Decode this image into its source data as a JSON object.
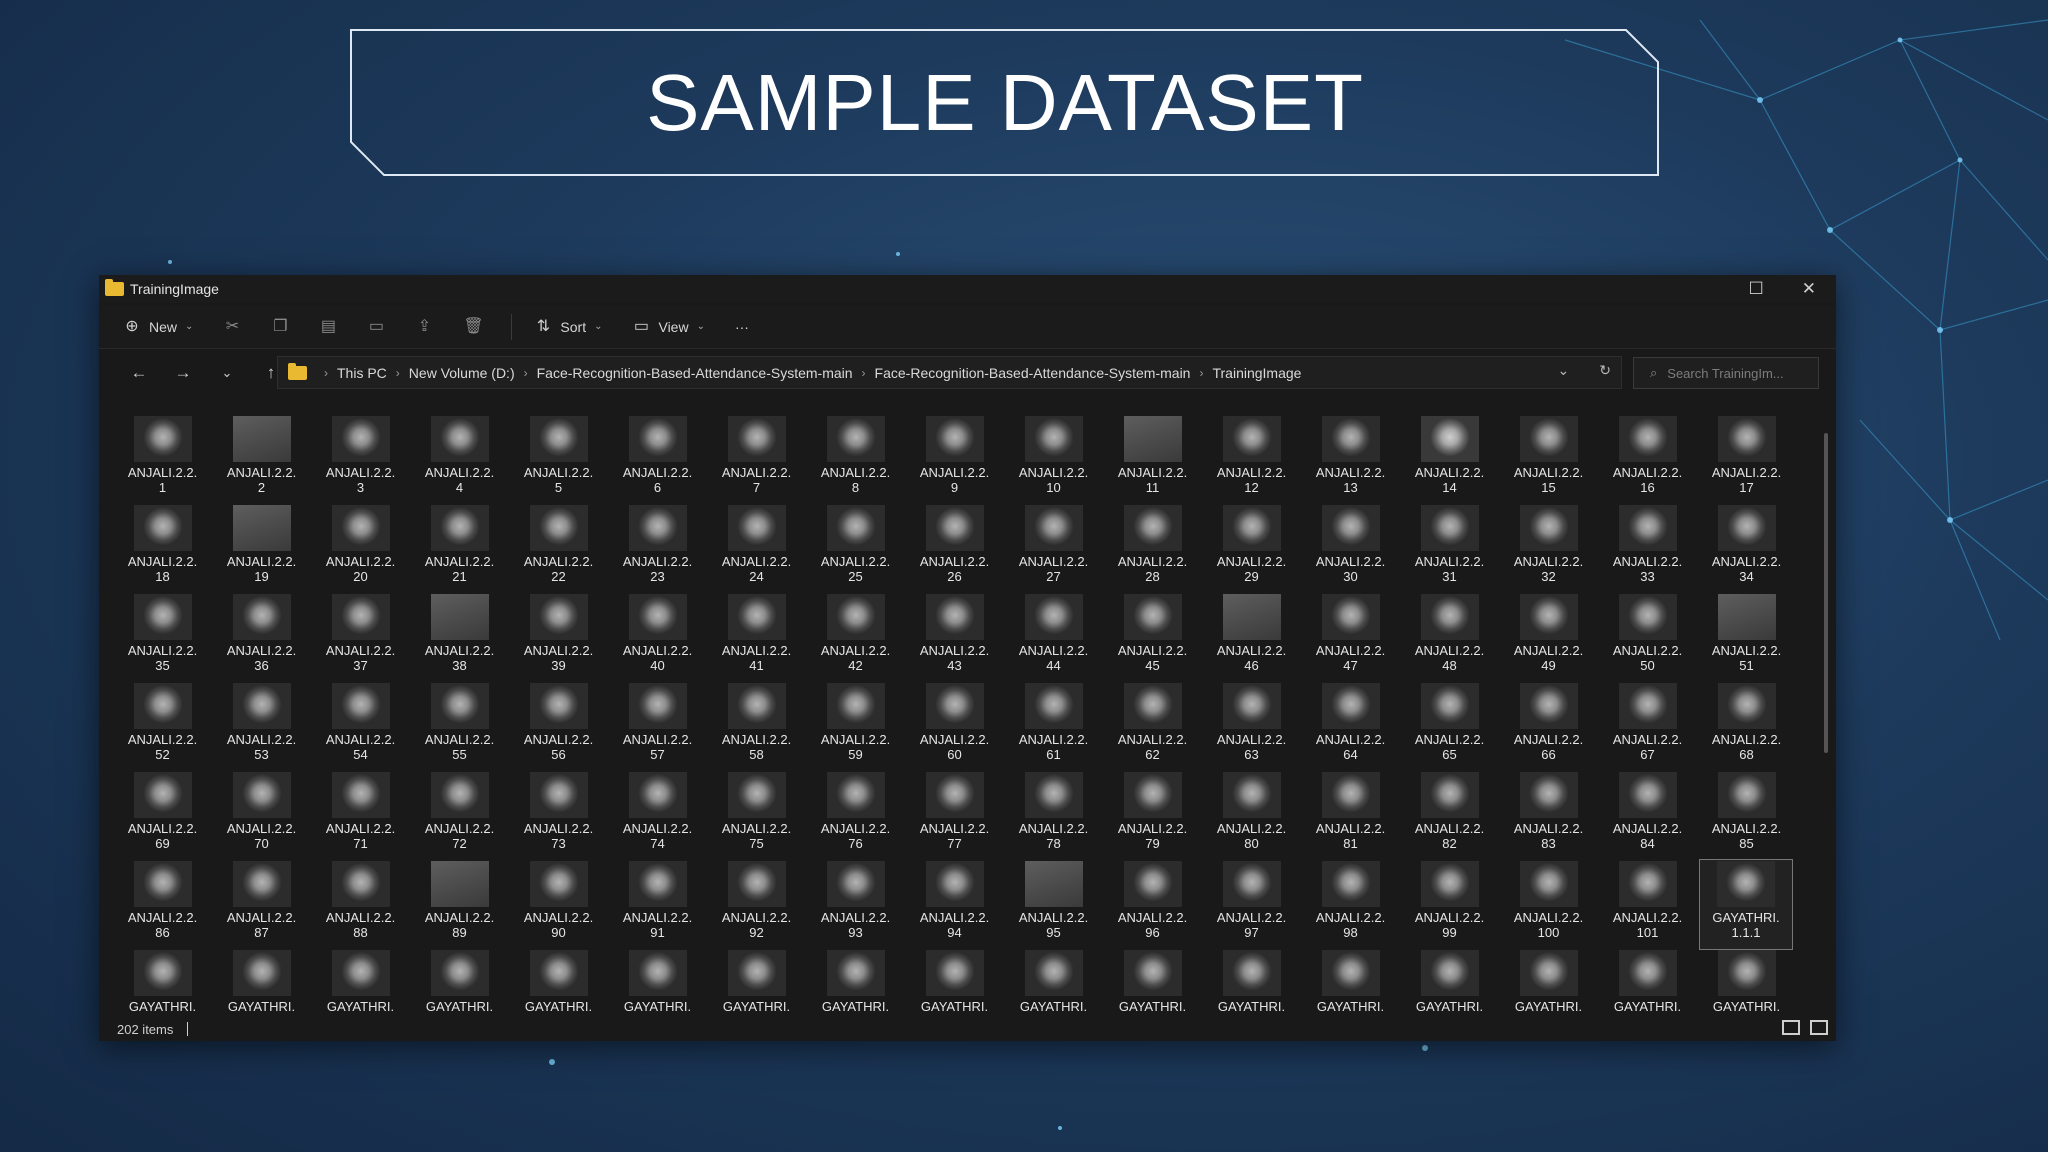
{
  "slide": {
    "title": "SAMPLE DATASET"
  },
  "window": {
    "title": "TrainingImage",
    "controls": {
      "maximize": "☐",
      "close": "✕"
    }
  },
  "toolbar": {
    "new_label": "New",
    "sort_label": "Sort",
    "view_label": "View",
    "more_label": "···"
  },
  "address": {
    "crumbs": [
      "This PC",
      "New Volume (D:)",
      "Face-Recognition-Based-Attendance-System-main",
      "Face-Recognition-Based-Attendance-System-main",
      "TrainingImage"
    ],
    "search_placeholder": "Search TrainingIm..."
  },
  "files": [
    {
      "line1": "ANJALI.2.2.",
      "line2": "1"
    },
    {
      "line1": "ANJALI.2.2.",
      "line2": "2",
      "alt": true
    },
    {
      "line1": "ANJALI.2.2.",
      "line2": "3"
    },
    {
      "line1": "ANJALI.2.2.",
      "line2": "4"
    },
    {
      "line1": "ANJALI.2.2.",
      "line2": "5"
    },
    {
      "line1": "ANJALI.2.2.",
      "line2": "6"
    },
    {
      "line1": "ANJALI.2.2.",
      "line2": "7"
    },
    {
      "line1": "ANJALI.2.2.",
      "line2": "8"
    },
    {
      "line1": "ANJALI.2.2.",
      "line2": "9"
    },
    {
      "line1": "ANJALI.2.2.",
      "line2": "10"
    },
    {
      "line1": "ANJALI.2.2.",
      "line2": "11",
      "alt": true
    },
    {
      "line1": "ANJALI.2.2.",
      "line2": "12"
    },
    {
      "line1": "ANJALI.2.2.",
      "line2": "13"
    },
    {
      "line1": "ANJALI.2.2.",
      "line2": "14",
      "light": true
    },
    {
      "line1": "ANJALI.2.2.",
      "line2": "15"
    },
    {
      "line1": "ANJALI.2.2.",
      "line2": "16"
    },
    {
      "line1": "ANJALI.2.2.",
      "line2": "17"
    },
    {
      "line1": "ANJALI.2.2.",
      "line2": "18"
    },
    {
      "line1": "ANJALI.2.2.",
      "line2": "19",
      "alt": true
    },
    {
      "line1": "ANJALI.2.2.",
      "line2": "20"
    },
    {
      "line1": "ANJALI.2.2.",
      "line2": "21"
    },
    {
      "line1": "ANJALI.2.2.",
      "line2": "22"
    },
    {
      "line1": "ANJALI.2.2.",
      "line2": "23"
    },
    {
      "line1": "ANJALI.2.2.",
      "line2": "24"
    },
    {
      "line1": "ANJALI.2.2.",
      "line2": "25"
    },
    {
      "line1": "ANJALI.2.2.",
      "line2": "26"
    },
    {
      "line1": "ANJALI.2.2.",
      "line2": "27"
    },
    {
      "line1": "ANJALI.2.2.",
      "line2": "28"
    },
    {
      "line1": "ANJALI.2.2.",
      "line2": "29"
    },
    {
      "line1": "ANJALI.2.2.",
      "line2": "30"
    },
    {
      "line1": "ANJALI.2.2.",
      "line2": "31"
    },
    {
      "line1": "ANJALI.2.2.",
      "line2": "32"
    },
    {
      "line1": "ANJALI.2.2.",
      "line2": "33"
    },
    {
      "line1": "ANJALI.2.2.",
      "line2": "34"
    },
    {
      "line1": "ANJALI.2.2.",
      "line2": "35"
    },
    {
      "line1": "ANJALI.2.2.",
      "line2": "36"
    },
    {
      "line1": "ANJALI.2.2.",
      "line2": "37"
    },
    {
      "line1": "ANJALI.2.2.",
      "line2": "38",
      "alt": true
    },
    {
      "line1": "ANJALI.2.2.",
      "line2": "39"
    },
    {
      "line1": "ANJALI.2.2.",
      "line2": "40"
    },
    {
      "line1": "ANJALI.2.2.",
      "line2": "41"
    },
    {
      "line1": "ANJALI.2.2.",
      "line2": "42"
    },
    {
      "line1": "ANJALI.2.2.",
      "line2": "43"
    },
    {
      "line1": "ANJALI.2.2.",
      "line2": "44"
    },
    {
      "line1": "ANJALI.2.2.",
      "line2": "45"
    },
    {
      "line1": "ANJALI.2.2.",
      "line2": "46",
      "alt": true
    },
    {
      "line1": "ANJALI.2.2.",
      "line2": "47"
    },
    {
      "line1": "ANJALI.2.2.",
      "line2": "48"
    },
    {
      "line1": "ANJALI.2.2.",
      "line2": "49"
    },
    {
      "line1": "ANJALI.2.2.",
      "line2": "50"
    },
    {
      "line1": "ANJALI.2.2.",
      "line2": "51",
      "alt": true
    },
    {
      "line1": "ANJALI.2.2.",
      "line2": "52"
    },
    {
      "line1": "ANJALI.2.2.",
      "line2": "53"
    },
    {
      "line1": "ANJALI.2.2.",
      "line2": "54"
    },
    {
      "line1": "ANJALI.2.2.",
      "line2": "55"
    },
    {
      "line1": "ANJALI.2.2.",
      "line2": "56"
    },
    {
      "line1": "ANJALI.2.2.",
      "line2": "57"
    },
    {
      "line1": "ANJALI.2.2.",
      "line2": "58"
    },
    {
      "line1": "ANJALI.2.2.",
      "line2": "59"
    },
    {
      "line1": "ANJALI.2.2.",
      "line2": "60"
    },
    {
      "line1": "ANJALI.2.2.",
      "line2": "61"
    },
    {
      "line1": "ANJALI.2.2.",
      "line2": "62"
    },
    {
      "line1": "ANJALI.2.2.",
      "line2": "63"
    },
    {
      "line1": "ANJALI.2.2.",
      "line2": "64"
    },
    {
      "line1": "ANJALI.2.2.",
      "line2": "65"
    },
    {
      "line1": "ANJALI.2.2.",
      "line2": "66"
    },
    {
      "line1": "ANJALI.2.2.",
      "line2": "67"
    },
    {
      "line1": "ANJALI.2.2.",
      "line2": "68"
    },
    {
      "line1": "ANJALI.2.2.",
      "line2": "69"
    },
    {
      "line1": "ANJALI.2.2.",
      "line2": "70"
    },
    {
      "line1": "ANJALI.2.2.",
      "line2": "71"
    },
    {
      "line1": "ANJALI.2.2.",
      "line2": "72"
    },
    {
      "line1": "ANJALI.2.2.",
      "line2": "73"
    },
    {
      "line1": "ANJALI.2.2.",
      "line2": "74"
    },
    {
      "line1": "ANJALI.2.2.",
      "line2": "75"
    },
    {
      "line1": "ANJALI.2.2.",
      "line2": "76"
    },
    {
      "line1": "ANJALI.2.2.",
      "line2": "77"
    },
    {
      "line1": "ANJALI.2.2.",
      "line2": "78"
    },
    {
      "line1": "ANJALI.2.2.",
      "line2": "79"
    },
    {
      "line1": "ANJALI.2.2.",
      "line2": "80"
    },
    {
      "line1": "ANJALI.2.2.",
      "line2": "81"
    },
    {
      "line1": "ANJALI.2.2.",
      "line2": "82"
    },
    {
      "line1": "ANJALI.2.2.",
      "line2": "83"
    },
    {
      "line1": "ANJALI.2.2.",
      "line2": "84"
    },
    {
      "line1": "ANJALI.2.2.",
      "line2": "85"
    },
    {
      "line1": "ANJALI.2.2.",
      "line2": "86"
    },
    {
      "line1": "ANJALI.2.2.",
      "line2": "87"
    },
    {
      "line1": "ANJALI.2.2.",
      "line2": "88"
    },
    {
      "line1": "ANJALI.2.2.",
      "line2": "89",
      "alt": true
    },
    {
      "line1": "ANJALI.2.2.",
      "line2": "90"
    },
    {
      "line1": "ANJALI.2.2.",
      "line2": "91"
    },
    {
      "line1": "ANJALI.2.2.",
      "line2": "92"
    },
    {
      "line1": "ANJALI.2.2.",
      "line2": "93"
    },
    {
      "line1": "ANJALI.2.2.",
      "line2": "94"
    },
    {
      "line1": "ANJALI.2.2.",
      "line2": "95",
      "alt": true
    },
    {
      "line1": "ANJALI.2.2.",
      "line2": "96"
    },
    {
      "line1": "ANJALI.2.2.",
      "line2": "97"
    },
    {
      "line1": "ANJALI.2.2.",
      "line2": "98"
    },
    {
      "line1": "ANJALI.2.2.",
      "line2": "99"
    },
    {
      "line1": "ANJALI.2.2.",
      "line2": "100"
    },
    {
      "line1": "ANJALI.2.2.",
      "line2": "101"
    },
    {
      "line1": "GAYATHRI.",
      "line2": "1.1.1",
      "selected": true
    },
    {
      "line1": "GAYATHRI.",
      "line2": ""
    },
    {
      "line1": "GAYATHRI.",
      "line2": ""
    },
    {
      "line1": "GAYATHRI.",
      "line2": ""
    },
    {
      "line1": "GAYATHRI.",
      "line2": ""
    },
    {
      "line1": "GAYATHRI.",
      "line2": ""
    },
    {
      "line1": "GAYATHRI.",
      "line2": ""
    },
    {
      "line1": "GAYATHRI.",
      "line2": ""
    },
    {
      "line1": "GAYATHRI.",
      "line2": ""
    },
    {
      "line1": "GAYATHRI.",
      "line2": ""
    },
    {
      "line1": "GAYATHRI.",
      "line2": ""
    },
    {
      "line1": "GAYATHRI.",
      "line2": ""
    },
    {
      "line1": "GAYATHRI.",
      "line2": ""
    },
    {
      "line1": "GAYATHRI.",
      "line2": ""
    },
    {
      "line1": "GAYATHRI.",
      "line2": ""
    },
    {
      "line1": "GAYATHRI.",
      "line2": ""
    },
    {
      "line1": "GAYATHRI.",
      "line2": ""
    },
    {
      "line1": "GAYATHRI.",
      "line2": ""
    }
  ],
  "status": {
    "items_count": "202 items"
  },
  "colors": {
    "folder": "#e8b931",
    "window_bg": "#191919",
    "slide_bg": "#1d3a5c"
  }
}
